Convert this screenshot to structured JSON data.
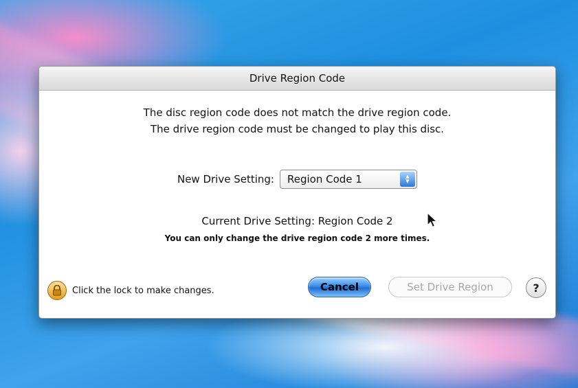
{
  "dialog": {
    "title": "Drive Region Code",
    "message_line1": "The disc region code does not match the drive region code.",
    "message_line2": "The drive region code must be changed to play this disc.",
    "new_setting_label": "New Drive Setting:",
    "new_setting_value": "Region Code 1",
    "current_setting": "Current Drive Setting: Region Code 2",
    "warning": "You can only change the drive region code 2 more times.",
    "lock_text": "Click the lock to make changes.",
    "cancel_label": "Cancel",
    "set_label": "Set Drive Region",
    "help_label": "?"
  },
  "icons": {
    "lock": "lock-icon",
    "help": "help-icon",
    "stepper": "up-down-chevron-icon",
    "cursor": "mouse-pointer-icon"
  },
  "colors": {
    "accent": "#3a8ee8",
    "disabled_text": "#a7a7a7",
    "lock": "#e59b20"
  }
}
